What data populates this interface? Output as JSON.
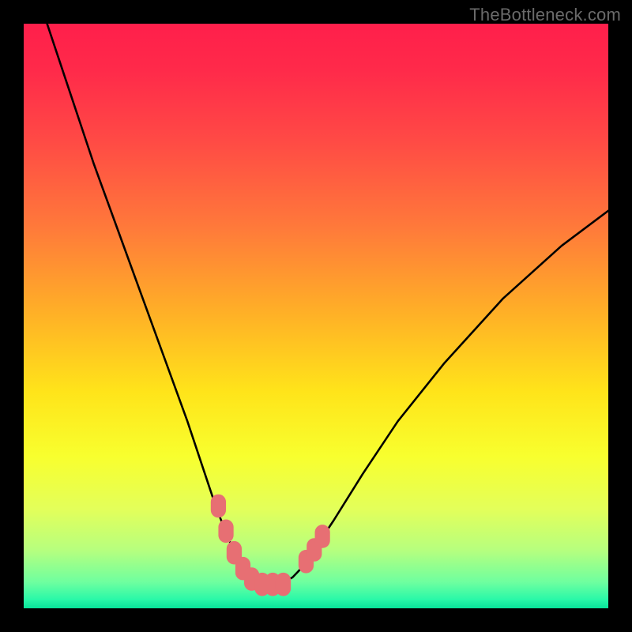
{
  "watermark": "TheBottleneck.com",
  "colors": {
    "background": "#000000",
    "gradient_stops": [
      {
        "offset": 0.0,
        "color": "#ff1f4b"
      },
      {
        "offset": 0.08,
        "color": "#ff2a4a"
      },
      {
        "offset": 0.2,
        "color": "#ff4a45"
      },
      {
        "offset": 0.35,
        "color": "#ff7a3a"
      },
      {
        "offset": 0.5,
        "color": "#ffb226"
      },
      {
        "offset": 0.63,
        "color": "#ffe41a"
      },
      {
        "offset": 0.74,
        "color": "#f8ff2e"
      },
      {
        "offset": 0.83,
        "color": "#e3ff5a"
      },
      {
        "offset": 0.9,
        "color": "#b7ff7e"
      },
      {
        "offset": 0.955,
        "color": "#6fff9f"
      },
      {
        "offset": 0.985,
        "color": "#29f8a8"
      },
      {
        "offset": 1.0,
        "color": "#08e39a"
      }
    ],
    "curve_black": "#000000",
    "marker_pink": "#e76f73"
  },
  "chart_data": {
    "type": "line",
    "title": "",
    "xlabel": "",
    "ylabel": "",
    "xlim": [
      0,
      100
    ],
    "ylim": [
      0,
      100
    ],
    "series": [
      {
        "name": "black-curve",
        "x": [
          4,
          8,
          12,
          16,
          20,
          24,
          28,
          31,
          33,
          35,
          36.5,
          38,
          39.5,
          41,
          42.5,
          44,
          46,
          48,
          50,
          53,
          58,
          64,
          72,
          82,
          92,
          100
        ],
        "y": [
          100,
          88,
          76,
          65,
          54,
          43,
          32,
          23,
          17,
          12,
          8.5,
          6,
          4.5,
          4,
          4,
          4.3,
          5.3,
          7.4,
          10.5,
          15,
          23,
          32,
          42,
          53,
          62,
          68
        ]
      }
    ],
    "markers": [
      {
        "x": 33.3,
        "y": 17.5
      },
      {
        "x": 34.6,
        "y": 13.2
      },
      {
        "x": 36.0,
        "y": 9.5
      },
      {
        "x": 37.5,
        "y": 6.8
      },
      {
        "x": 39.0,
        "y": 5.0
      },
      {
        "x": 40.8,
        "y": 4.1
      },
      {
        "x": 42.6,
        "y": 4.1
      },
      {
        "x": 44.4,
        "y": 4.1
      },
      {
        "x": 48.3,
        "y": 8.0
      },
      {
        "x": 49.7,
        "y": 10.0
      },
      {
        "x": 51.1,
        "y": 12.3
      }
    ]
  }
}
